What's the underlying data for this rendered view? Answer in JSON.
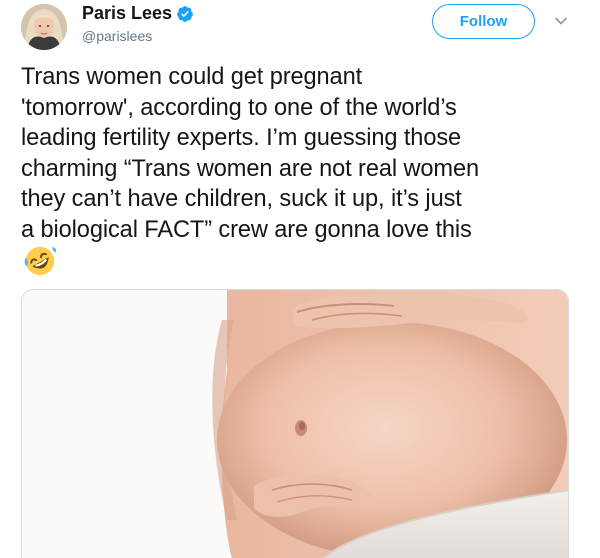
{
  "user": {
    "display_name": "Paris Lees",
    "handle": "@parislees",
    "verified": true,
    "avatar_icon": "user-avatar"
  },
  "follow_button": {
    "label": "Follow"
  },
  "tweet": {
    "lines": [
      "Trans women could get pregnant",
      "'tomorrow', according to one of the world’s",
      "leading fertility experts. I’m guessing those",
      "charming “Trans women are not real women",
      "they can’t have children, suck it up, it’s just",
      "a biological FACT” crew are gonna love this"
    ],
    "emoji": "rolling-on-floor-laughing"
  },
  "media": {
    "icon": "pregnant-belly-photo"
  },
  "colors": {
    "accent": "#1da1f2",
    "text": "#14171a",
    "secondary": "#657786"
  }
}
